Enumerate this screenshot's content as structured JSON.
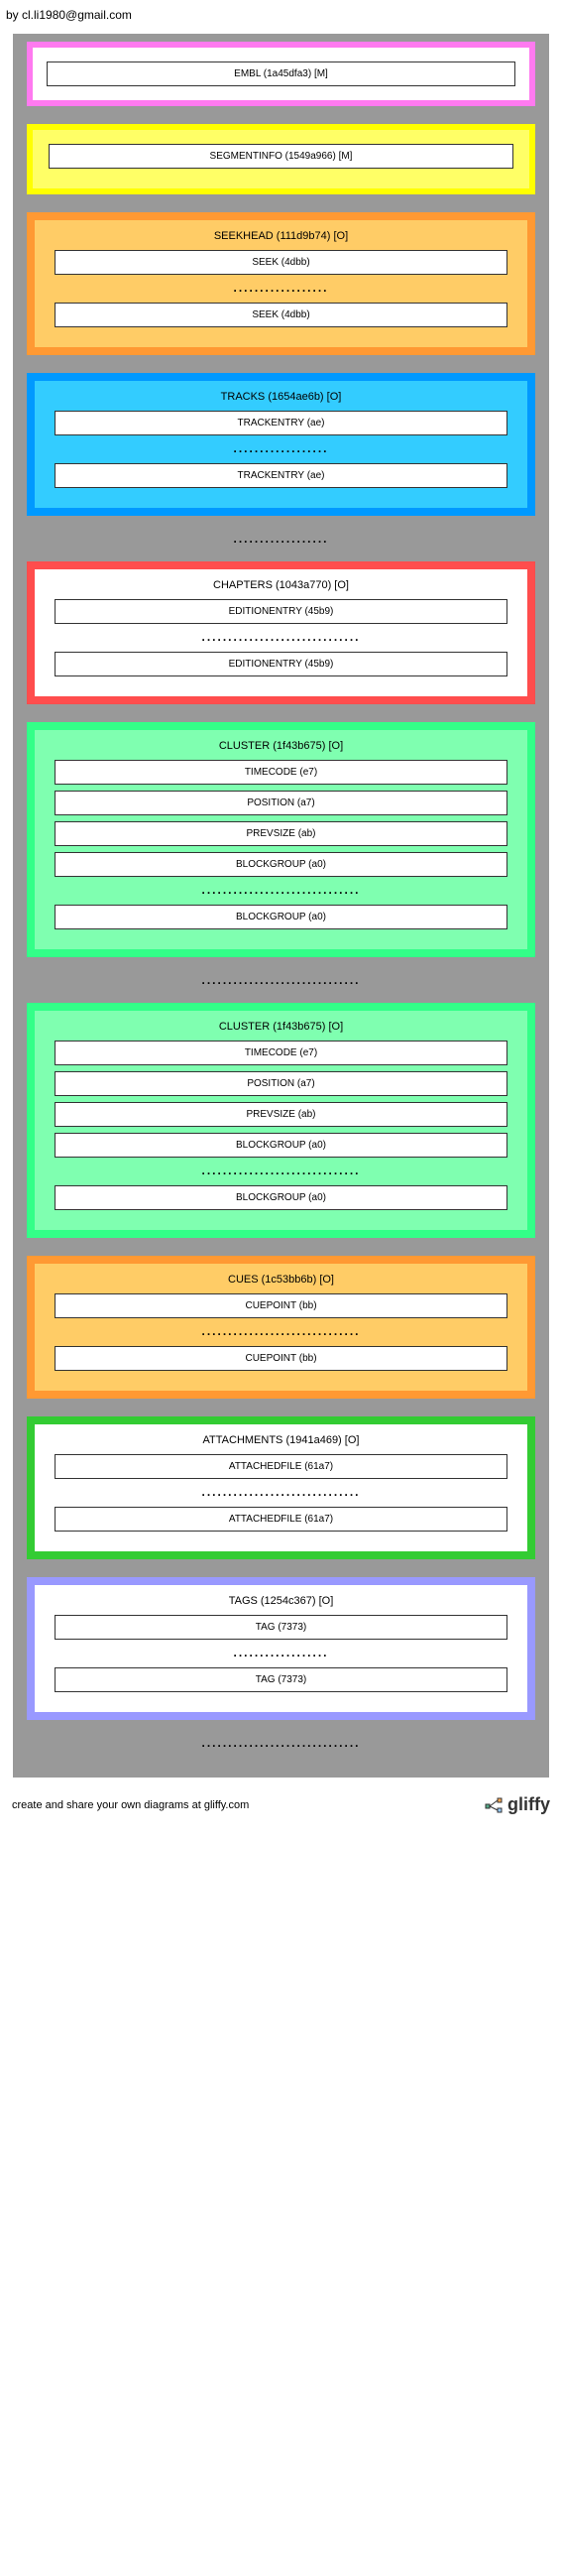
{
  "author": "by cl.li1980@gmail.com",
  "footer": "create and share your own diagrams at gliffy.com",
  "brand": "gliffy",
  "dots": "..................",
  "dots_long": "..............................",
  "blocks": {
    "embl": {
      "item": "EMBL (1a45dfa3) [M]"
    },
    "segmentinfo": {
      "item": "SEGMENTINFO (1549a966) [M]"
    },
    "seekhead": {
      "title": "SEEKHEAD (111d9b74) [O]",
      "item": "SEEK (4dbb)"
    },
    "tracks": {
      "title": "TRACKS (1654ae6b) [O]",
      "item": "TRACKENTRY (ae)"
    },
    "chapters": {
      "title": "CHAPTERS (1043a770) [O]",
      "item": "EDITIONENTRY (45b9)"
    },
    "cluster": {
      "title": "CLUSTER (1f43b675) [O]",
      "timecode": "TIMECODE (e7)",
      "position": "POSITION (a7)",
      "prevsize": "PREVSIZE (ab)",
      "blockgroup": "BLOCKGROUP (a0)"
    },
    "cues": {
      "title": "CUES (1c53bb6b) [O]",
      "item": "CUEPOINT (bb)"
    },
    "attachments": {
      "title": "ATTACHMENTS (1941a469) [O]",
      "item": "ATTACHEDFILE (61a7)"
    },
    "tags": {
      "title": "TAGS (1254c367) [O]",
      "item": "TAG (7373)"
    }
  }
}
